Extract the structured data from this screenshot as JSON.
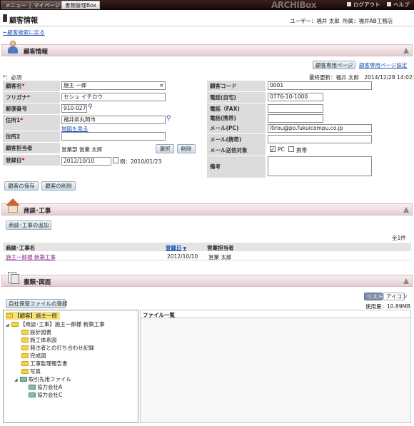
{
  "topnav": {
    "tabs": [
      "メニュー",
      "マイページ",
      "書類管理Box"
    ],
    "logo": "ARCHIBox",
    "logout": "ログアウト",
    "help": "ヘルプ"
  },
  "header": {
    "title": "顧客情報",
    "user": "ユーザー：福井 太郎",
    "org": "所属：福井AB工務店",
    "back_link": "←顧客検索に戻る"
  },
  "customer_section": {
    "title": "顧客情報",
    "page_button": "顧客専用ページ",
    "page_settings_link": "顧客専用ページ設定",
    "required_note": "：必須",
    "updated": "最終更新：福井 太郎　2014/12/28 14:02:38",
    "fields": {
      "name_label": "顧客名",
      "name_value": "施主 一郎",
      "kana_label": "フリガナ",
      "kana_value": "セシュ イチロウ",
      "zip_label": "郵便番号",
      "zip_value": "910-0276",
      "addr1_label": "住所1",
      "addr1_value": "福井県丸岡市",
      "map_link": "地図を見る",
      "addr2_label": "住所2",
      "addr2_value": "",
      "staff_label": "顧客担当者",
      "staff_value": "営業部 営業 太郎",
      "select_button": "選択",
      "delete_button": "削除",
      "regdate_label": "登録日",
      "regdate_value": "2012/10/10",
      "regdate_example": "例：2010/01/23",
      "code_label": "顧客コード",
      "code_value": "0001",
      "tel_home_label": "電話(自宅)",
      "tel_home_value": "0776-10-1000",
      "fax_label": "電話（FAX)",
      "fax_value": "",
      "mobile_label": "電話(携帯)",
      "mobile_value": "",
      "mail_pc_label": "メール(PC)",
      "mail_pc_value": "itirou@po.fukuicompu.co.jp",
      "mail_mobile_label": "メール(携帯)",
      "mail_mobile_value": "",
      "mail_target_label": "メール送信対象",
      "mail_target_pc": "PC",
      "mail_target_mobile": "携帯",
      "memo_label": "備考",
      "memo_value": ""
    },
    "save_button": "顧客の保存",
    "delete_customer_button": "顧客の削除"
  },
  "project_section": {
    "title": "商談･工事",
    "add_button": "商談･工事の追加",
    "count": "全1件",
    "columns": [
      "商談･工事名",
      "登録日",
      "営業担当者"
    ],
    "sort_mark": "▼",
    "rows": [
      {
        "name": "施主一郎様 新築工事",
        "date": "2012/10/10",
        "staff": "営業 太郎"
      }
    ]
  },
  "docs_section": {
    "title": "書類･図面",
    "register_button": "自社保管ファイルの登録",
    "view_list": "リスト",
    "view_icon": "アイコン",
    "usage": "使用量：10.89MB",
    "file_list_title": "ファイル一覧",
    "tree": [
      "【顧客】施主一郎",
      "【商談･工事】施主一郎様 新築工事",
      "設計図書",
      "施工体系図",
      "発注者との打ち合わせ記録",
      "完成図",
      "工事監理報告書",
      "写真",
      "取引先用ファイル",
      "協力会社A",
      "協力会社C"
    ]
  },
  "colors": {
    "topbar": "#1a0c0c",
    "section_header": "#ecd9dd",
    "link": "#1a4fb5",
    "required": "#cc0000",
    "selected_tree": "#f5e27a"
  }
}
